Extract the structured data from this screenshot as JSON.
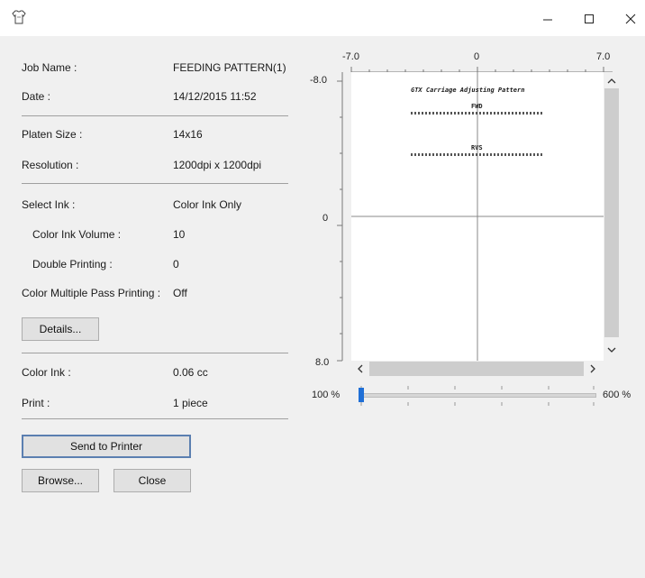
{
  "window": {
    "minimize_icon": "minimize-icon",
    "maximize_icon": "maximize-icon",
    "close_icon": "close-icon"
  },
  "info": {
    "job_name_label": "Job Name :",
    "job_name_value": "FEEDING PATTERN(1)",
    "date_label": "Date :",
    "date_value": "14/12/2015 11:52",
    "platen_label": "Platen Size :",
    "platen_value": "14x16",
    "resolution_label": "Resolution :",
    "resolution_value": "1200dpi x 1200dpi",
    "select_ink_label": "Select Ink :",
    "select_ink_value": "Color Ink Only",
    "color_ink_volume_label": "Color Ink Volume :",
    "color_ink_volume_value": "10",
    "double_printing_label": "Double Printing :",
    "double_printing_value": "0",
    "multipass_label": "Color Multiple Pass Printing :",
    "multipass_value": "Off",
    "details_button": "Details...",
    "color_ink_label": "Color Ink :",
    "color_ink_value": "0.06 cc",
    "print_label": "Print :",
    "print_value": "1 piece"
  },
  "buttons": {
    "send": "Send to Printer",
    "browse": "Browse...",
    "close": "Close"
  },
  "preview": {
    "x_min": "-7.0",
    "x_mid": "0",
    "x_max": "7.0",
    "y_min": "-8.0",
    "y_mid": "0",
    "y_max": "8.0",
    "pattern_title": "GTX Carriage Adjusting Pattern",
    "fwd_label": "FWD",
    "rvs_label": "RVS"
  },
  "zoom": {
    "min_label": "100 %",
    "max_label": "600 %",
    "value_fraction": 0
  }
}
